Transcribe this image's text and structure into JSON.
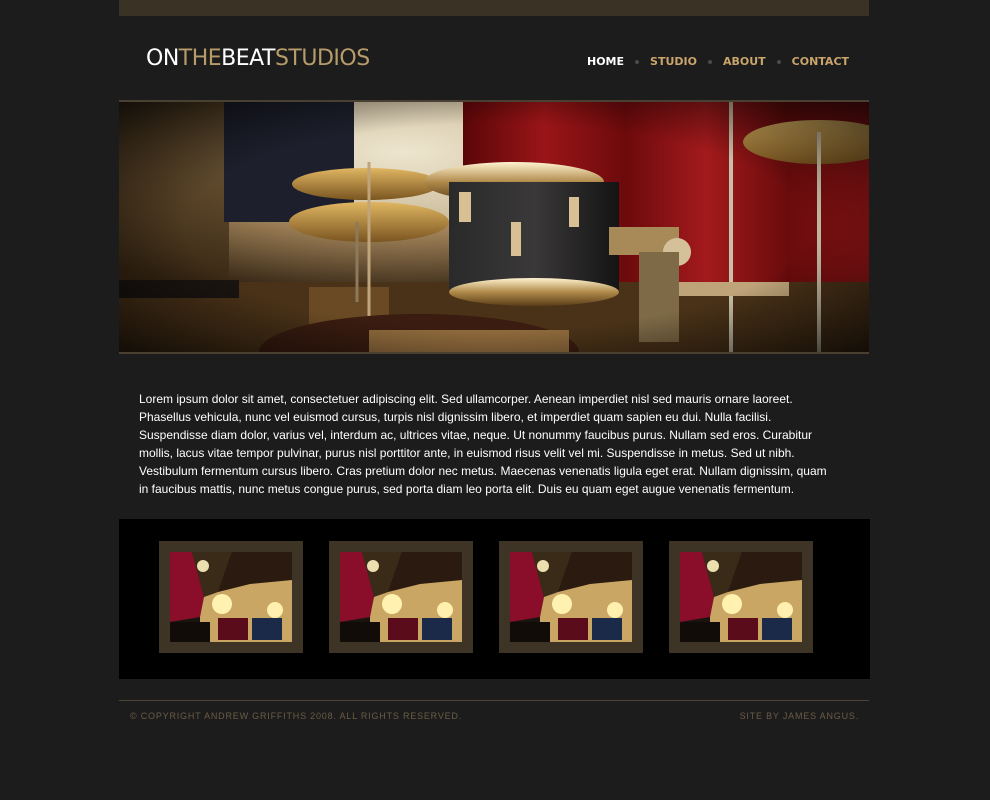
{
  "brand": {
    "part1": "ON",
    "part2": "THE",
    "part3": "BEAT",
    "part4": "STUDIOS"
  },
  "nav": {
    "items": [
      "HOME",
      "STUDIO",
      "ABOUT",
      "CONTACT"
    ],
    "active": "HOME"
  },
  "intro": "Lorem ipsum dolor sit amet, consectetuer adipiscing elit. Sed ullamcorper. Aenean imperdiet nisl sed mauris ornare laoreet. Phasellus vehicula, nunc vel euismod cursus, turpis nisl dignissim libero, et imperdiet quam sapien eu dui. Nulla facilisi. Suspendisse diam dolor, varius vel, interdum ac, ultrices vitae, neque. Ut nonummy faucibus purus. Nullam sed eros. Curabitur mollis, lacus vitae tempor pulvinar, purus nisl porttitor ante, in euismod risus velit vel mi. Suspendisse in metus. Sed ut nibh. Vestibulum fermentum cursus libero. Cras pretium dolor nec metus. Maecenas venenatis ligula eget erat. Nullam dignissim, quam in faucibus mattis, nunc metus congue purus, sed porta diam leo porta elit. Duis eu quam eget augue venenatis fermentum.",
  "footer": {
    "copyright": "© COPYRIGHT ANDREW GRIFFITHS 2008. ALL RIGHTS RESERVED.",
    "credit": "SITE BY JAMES ANGUS."
  },
  "colors": {
    "accent": "#b79c6a",
    "background": "#1c1c1c"
  }
}
